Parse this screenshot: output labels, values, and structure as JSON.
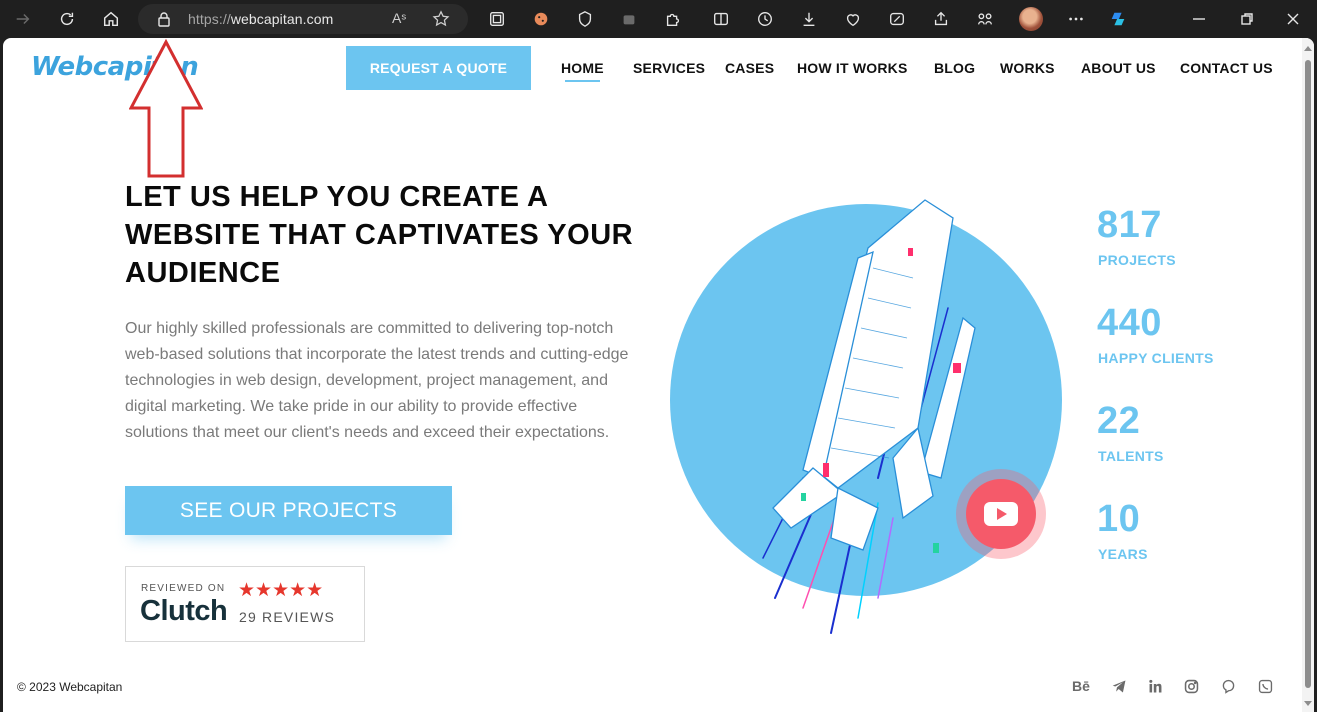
{
  "browser": {
    "url_scheme": "https://",
    "url_host": "webcapitan.com",
    "read_aloud": "Aˢ"
  },
  "site": {
    "logo": "Webcapitan",
    "request_quote": "REQUEST A QUOTE",
    "nav": [
      "HOME",
      "SERVICES",
      "CASES",
      "HOW IT WORKS",
      "BLOG",
      "WORKS",
      "ABOUT US",
      "CONTACT US"
    ],
    "active_nav": "HOME"
  },
  "hero": {
    "headline": "LET US HELP YOU CREATE A WEBSITE THAT CAPTIVATES YOUR AUDIENCE",
    "description": "Our highly skilled professionals are committed to delivering top-notch web-based solutions that incorporate the latest trends and cutting-edge technologies in web design, development, project management, and digital marketing. We take pride in our ability to provide effective solutions that meet our client's needs and exceed their expectations.",
    "cta": "SEE OUR PROJECTS"
  },
  "clutch": {
    "reviewed_on": "REVIEWED ON",
    "brand": "Clutch",
    "stars": "★★★★★",
    "rating": 5,
    "reviews": "29 REVIEWS"
  },
  "stats": [
    {
      "number": "817",
      "label": "PROJECTS"
    },
    {
      "number": "440",
      "label": "HAPPY CLIENTS"
    },
    {
      "number": "22",
      "label": "TALENTS"
    },
    {
      "number": "10",
      "label": "YEARS"
    }
  ],
  "footer": {
    "copyright": "© 2023 Webcapitan",
    "behance": "Bē"
  },
  "colors": {
    "accent": "#6cc5f0",
    "annotation_arrow": "#d32f2f",
    "play_button": "#f55a6a"
  }
}
